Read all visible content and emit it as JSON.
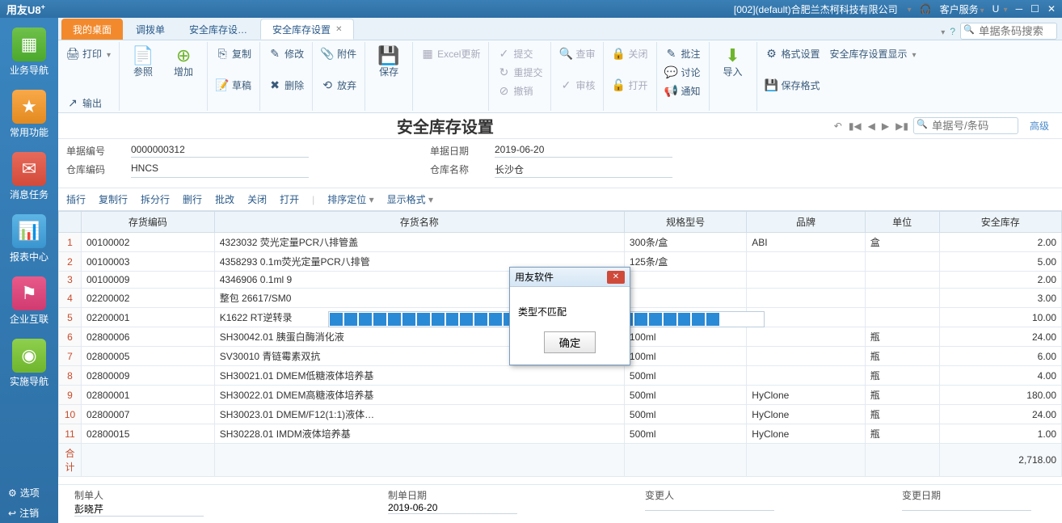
{
  "topbar": {
    "brand": "用友U8",
    "brand_sup": "+",
    "company": "[002](default)合肥兰杰柯科技有限公司",
    "service": "客户服务",
    "u_label": "U"
  },
  "sidebar": {
    "items": [
      {
        "label": "业务导航"
      },
      {
        "label": "常用功能"
      },
      {
        "label": "消息任务"
      },
      {
        "label": "报表中心"
      },
      {
        "label": "企业互联"
      },
      {
        "label": "实施导航"
      }
    ],
    "bottom": [
      {
        "label": "选项"
      },
      {
        "label": "注销"
      }
    ]
  },
  "tabs": [
    {
      "label": "我的桌面"
    },
    {
      "label": "调拨单"
    },
    {
      "label": "安全库存设…"
    },
    {
      "label": "安全库存设置"
    }
  ],
  "search_placeholder": "单据条码搜索",
  "toolbar": {
    "print": "打印",
    "output": "输出",
    "ref": "参照",
    "add": "增加",
    "copy": "复制",
    "edit": "修改",
    "draft": "草稿",
    "delete": "删除",
    "attach": "附件",
    "abandon": "放弃",
    "save": "保存",
    "excel": "Excel更新",
    "submit": "提交",
    "revalidate": "重提交",
    "revoke": "撤销",
    "review": "查审",
    "audit": "审核",
    "close": "关闭",
    "open": "打开",
    "approval": "批注",
    "discuss": "讨论",
    "notify": "通知",
    "import": "导入",
    "format": "格式设置",
    "display": "安全库存设置显示",
    "saveformat": "保存格式"
  },
  "page": {
    "title": "安全库存设置",
    "doc_search_placeholder": "单据号/条码",
    "advanced": "高级"
  },
  "form": {
    "doc_no_label": "单据编号",
    "doc_no": "0000000312",
    "doc_date_label": "单据日期",
    "doc_date": "2019-06-20",
    "wh_code_label": "仓库编码",
    "wh_code": "HNCS",
    "wh_name_label": "仓库名称",
    "wh_name": "长沙仓"
  },
  "tbl_toolbar": {
    "insert": "插行",
    "copyrow": "复制行",
    "splitrow": "拆分行",
    "delrow": "删行",
    "batch": "批改",
    "close": "关闭",
    "open": "打开",
    "sortloc": "排序定位",
    "dispfmt": "显示格式"
  },
  "columns": [
    "存货编码",
    "存货名称",
    "规格型号",
    "品牌",
    "单位",
    "安全库存"
  ],
  "rows": [
    {
      "n": "1",
      "code": "00100002",
      "name": "4323032 荧光定量PCR八排管盖",
      "spec": "300条/盒",
      "brand": "ABI",
      "unit": "盒",
      "qty": "2.00"
    },
    {
      "n": "2",
      "code": "00100003",
      "name": "4358293 0.1m荧光定量PCR八排管",
      "spec": "125条/盒",
      "brand": "",
      "unit": "",
      "qty": "5.00"
    },
    {
      "n": "3",
      "code": "00100009",
      "name": "4346906 0.1ml 9",
      "spec": "",
      "brand": "",
      "unit": "",
      "qty": "2.00"
    },
    {
      "n": "4",
      "code": "02200002",
      "name": "整包 26617/SM0",
      "spec": "",
      "brand": "",
      "unit": "",
      "qty": "3.00"
    },
    {
      "n": "5",
      "code": "02200001",
      "name": "K1622 RT逆转录",
      "spec": "",
      "brand": "",
      "unit": "",
      "qty": "10.00"
    },
    {
      "n": "6",
      "code": "02800006",
      "name": "SH30042.01 胰蛋白酶消化液",
      "spec": "100ml",
      "brand": "",
      "unit": "瓶",
      "qty": "24.00"
    },
    {
      "n": "7",
      "code": "02800005",
      "name": "SV30010 青链霉素双抗",
      "spec": "100ml",
      "brand": "",
      "unit": "瓶",
      "qty": "6.00"
    },
    {
      "n": "8",
      "code": "02800009",
      "name": "SH30021.01 DMEM低糖液体培养基",
      "spec": "500ml",
      "brand": "",
      "unit": "瓶",
      "qty": "4.00"
    },
    {
      "n": "9",
      "code": "02800001",
      "name": "SH30022.01 DMEM高糖液体培养基",
      "spec": "500ml",
      "brand": "HyClone",
      "unit": "瓶",
      "qty": "180.00"
    },
    {
      "n": "10",
      "code": "02800007",
      "name": "SH30023.01 DMEM/F12(1:1)液体…",
      "spec": "500ml",
      "brand": "HyClone",
      "unit": "瓶",
      "qty": "24.00"
    },
    {
      "n": "11",
      "code": "02800015",
      "name": "SH30228.01 IMDM液体培养基",
      "spec": "500ml",
      "brand": "HyClone",
      "unit": "瓶",
      "qty": "1.00"
    }
  ],
  "total": {
    "label": "合计",
    "qty": "2,718.00"
  },
  "footer": {
    "maker_label": "制单人",
    "maker": "彭晓芹",
    "make_date_label": "制单日期",
    "make_date": "2019-06-20",
    "changer_label": "变更人",
    "changer": "",
    "change_date_label": "变更日期",
    "change_date": ""
  },
  "dialog": {
    "title": "用友软件",
    "message": "类型不匹配",
    "ok": "确定"
  }
}
